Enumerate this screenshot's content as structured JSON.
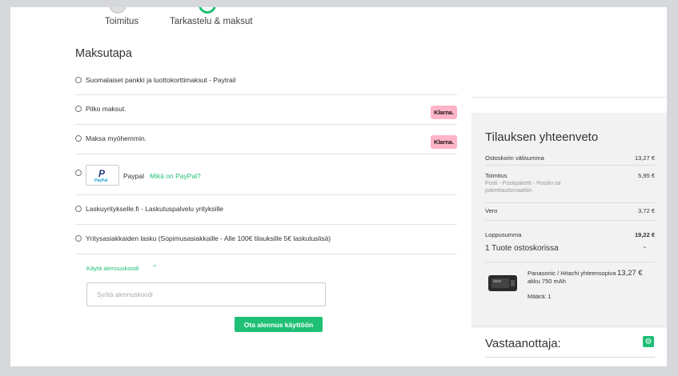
{
  "steps": [
    {
      "label": "Toimitus",
      "state": "done"
    },
    {
      "label": "Tarkastelu & maksut",
      "state": "active"
    }
  ],
  "payment": {
    "title": "Maksutapa",
    "options": [
      {
        "label": "Suomalaiset pankki ja luottokorttimaksut - Paytrail"
      },
      {
        "label": "Pilko maksut.",
        "badge": "Klarna."
      },
      {
        "label": "Maksa myöhemmin.",
        "badge": "Klarna."
      },
      {
        "label": "Paypal",
        "link": "Mikä on PayPal?",
        "logo": "PayPal"
      },
      {
        "label": "Laskuyritykselle.fi - Laskutuspalvelu yrityksille"
      },
      {
        "label": "Yritysasiakkaiden lasku (Sopimusasiakkaille - Alle 100€ tilauksille 5€ laskutuslisä)"
      }
    ]
  },
  "discount": {
    "toggle_label": "Käytä alennuskoodi",
    "placeholder": "Syötä alennuskoodi",
    "button_label": "Ota alennus käyttöön"
  },
  "summary": {
    "title": "Tilauksen yhteenveto",
    "subtotal_label": "Ostoskorin välisumma",
    "subtotal_value": "13,27 €",
    "shipping_label": "Toimitus",
    "shipping_value": "5,95 €",
    "shipping_detail": "Posti - Postipaketti - Postiin tai pakettiautomaattiin",
    "tax_label": "Vero",
    "tax_value": "3,72 €",
    "total_label": "Loppusumma",
    "total_value": "19,22 €",
    "items_title": "1 Tuote ostoskorissa",
    "item": {
      "name": "Panasonic / Hitachi yhteensopiva akku 750 mAh",
      "price": "13,27 €",
      "quantity": "Määrä: 1"
    }
  },
  "receiver": {
    "title": "Vastaanottaja:"
  },
  "colors": {
    "accent": "#1fbf75",
    "klarna": "#ffb3c7",
    "summary_bg": "#f2f2f2"
  }
}
